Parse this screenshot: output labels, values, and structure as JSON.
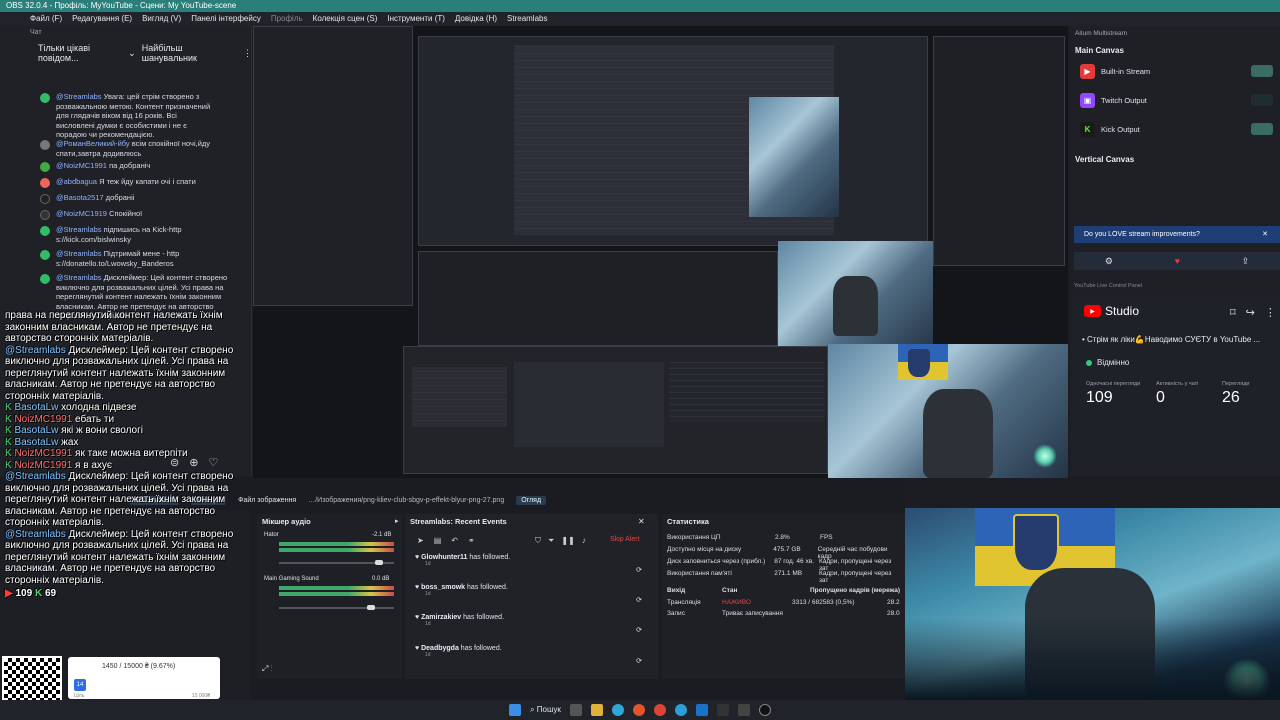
{
  "titlebar": {
    "text": "OBS 32.0.4 - Профіль: MyYouTube - Сцени: My YouTube-scene"
  },
  "menu": [
    "Файл (F)",
    "Редагування (E)",
    "Вигляд (V)",
    "Панелі інтерфейсу",
    "Профіль",
    "Колекція сцен (S)",
    "Інструменти (T)",
    "Довідка (H)",
    "Streamlabs"
  ],
  "chat": {
    "header": "Чат",
    "filter_label": "Тільки цікаві повідом...",
    "top_label": "Найбільш шанувальник",
    "messages": [
      {
        "user": "@Streamlabs",
        "text": "Увага: цей стрім створено з розважальною метою. Контент призначений для глядачів віком від 16 років. Всі висловлені думки є особистими і не є порадою чи рекомендацією."
      },
      {
        "user": "@РоманВеликий-йбу",
        "text": "всім спокійної ночі,йду спати,завтра додивлюсь"
      },
      {
        "user": "@NoizMC1991",
        "text": "па добраніч"
      },
      {
        "user": "@abdbagua",
        "text": "Я теж йду капати очі і спати"
      },
      {
        "user": "@Basota2517",
        "text": "добраніі"
      },
      {
        "user": "@NoizMC1919",
        "text": "Спокійної"
      },
      {
        "user": "@Streamlabs",
        "text": "підпишись на Kick-http s://kick.com/bislwinsky"
      },
      {
        "user": "@Streamlabs",
        "text": "Підтримай мене - http s://donatello.to/Lwowsky_Banderos"
      },
      {
        "user": "@Streamlabs",
        "text": "Дисклеймер: Цей контент створено виключно для розважальних цілей. Усі права на переглянутий контент належать їхнім законним власникам. Автор не претендує на авторство сторонніх матеріалів."
      }
    ]
  },
  "overlay": {
    "lines1": [
      "права на переглянутий контент належать їхнім",
      "законним власникам. Автор не претендує на",
      "авторство сторонніх матеріалів."
    ],
    "msg2_user": "@Streamlabs",
    "msg2_text": "Дисклеймер: Цей контент створено виключно для розважальних цілей. Усі права на переглянутий контент належать їхнім законним власникам. Автор не претендує на авторство сторонніх матеріалів.",
    "basota1": "BasotaLw",
    "basota1_text": "холодна підвезе",
    "noiz1": "NoizMC1991",
    "noiz1_text": "ебать ти",
    "basota2": "BasotaLw",
    "basota2_text": "які ж вони свологі",
    "basota3": "BasotaLw",
    "basota3_text": "жах",
    "noiz2": "NoizMC1991",
    "noiz2_text": "як таке можна витерпіти",
    "noiz3": "NoizMC1991",
    "noiz3_text": "я в ахує",
    "msg3_user": "@Streamlabs",
    "msg3_text": "Дисклеймер: Цей контент створено виключно для розважальних цілей. Усі права на переглянутий контент належать їхнім законним власникам. Автор не претендує на авторство сторонніх матеріалів.",
    "msg4_user": "@Streamlabs",
    "msg4_text": "Дисклеймер: Цей контент створено виключно для розважальних цілей. Усі права на переглянутий контент належать їхнім законним власникам. Автор не претендує на авторство сторонніх матеріалів.",
    "yt_count": "109",
    "kick_count": "69"
  },
  "props": {
    "properties": "Властивості",
    "filters": "Фільтри",
    "file_label": "Файл зображення",
    "file_path": "…/Изображения/png-kliev-club-sbgv-p-effekt-blyur-png-27.png",
    "review": "Огляд"
  },
  "mixer": {
    "title": "Мікшер аудіо",
    "ch1": "Hator",
    "ch1_db": "-2.1 dB",
    "ch2": "Main Gaming Sound",
    "ch2_db": "0.0 dB"
  },
  "events": {
    "title": "Streamlabs: Recent Events",
    "skip": "Skip Alert",
    "items": [
      {
        "name": "Glowhunter11",
        "action": "has followed."
      },
      {
        "name": "boss_smowk",
        "action": "has followed."
      },
      {
        "name": "Zamirzakiev",
        "action": "has followed."
      },
      {
        "name": "Deadbygda",
        "action": "has followed."
      }
    ],
    "time": "1d"
  },
  "stats": {
    "title": "Статистика",
    "rows": [
      [
        "Використання ЦП",
        "2.8%",
        "FPS"
      ],
      [
        "Доступно місця на диску",
        "475.7 GB",
        "Середній час побудови кадр"
      ],
      [
        "Диск заповниться через (прибл.)",
        "87 год. 46 хв.",
        "Кадри, пропущені через зат"
      ],
      [
        "Використання пам'яті",
        "271.1 MB",
        "Кадри, пропущені через зат"
      ]
    ],
    "hdr": [
      "Вихід",
      "Стан",
      "Пропущено кадрів (мережа)"
    ],
    "out": [
      [
        "Трансляція",
        "НАЖИВО",
        "3313 / 682583 (0,5%)",
        "28.2"
      ],
      [
        "Запис",
        "Триває записування",
        "",
        "28.0"
      ]
    ]
  },
  "multistream": {
    "header": "Aitum Multistream",
    "main": "Main Canvas",
    "items": [
      "Built-in Stream",
      "Twitch Output",
      "Kick Output"
    ],
    "vertical": "Vertical Canvas",
    "banner": "Do you LOVE stream improvements?",
    "live_panel": "YouTube Live Control Panel"
  },
  "studio": {
    "logo": "Studio",
    "stream": "Стрім як ліки💪Наводимо СУЄТУ в YouTube ...",
    "status": "Відмінно",
    "labels": [
      "Одночасні перегляди",
      "Активність у чаті",
      "Перегляди"
    ],
    "values": [
      "109",
      "0",
      "26"
    ]
  },
  "goal": {
    "text": "1450 / 15000 ₴ (9.67%)",
    "end": "15 000₴",
    "start": "Ціль"
  },
  "taskbar": {
    "search": "Пошук"
  },
  "colors": {
    "accent": "#2a7f7a",
    "live": "#e03a3a",
    "kick": "#53fc18",
    "youtube": "#ff0000",
    "twitch": "#9146ff"
  }
}
